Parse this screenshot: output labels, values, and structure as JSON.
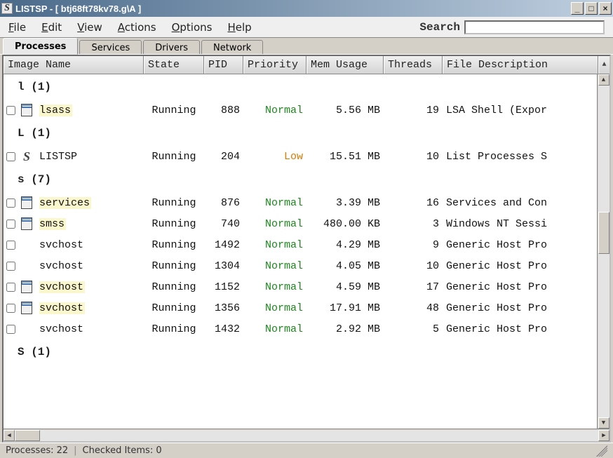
{
  "window": {
    "app": "LISTSP",
    "path": "btj68ft78kv78.g\\A",
    "title_full": "LISTSP - [ btj68ft78kv78.g\\A ]"
  },
  "menu": {
    "file": "File",
    "edit": "Edit",
    "view": "View",
    "actions": "Actions",
    "options": "Options",
    "help": "Help"
  },
  "search": {
    "label": "Search",
    "value": ""
  },
  "tabs": {
    "processes": "Processes",
    "services": "Services",
    "drivers": "Drivers",
    "network": "Network",
    "active": "processes"
  },
  "columns": {
    "image_name": "Image Name",
    "state": "State",
    "pid": "PID",
    "priority": "Priority",
    "mem_usage": "Mem Usage",
    "threads": "Threads",
    "file_description": "File Description"
  },
  "groups": [
    {
      "letter": "l",
      "count": 1,
      "rows": [
        {
          "name": "lsass",
          "highlight": true,
          "state": "Running",
          "pid": "888",
          "priority": "Normal",
          "priority_class": "normal",
          "mem": "5.56 MB",
          "threads": "19",
          "desc": "LSA Shell (Expor",
          "icon": "proc"
        }
      ]
    },
    {
      "letter": "L",
      "count": 1,
      "rows": [
        {
          "name": "LISTSP",
          "highlight": false,
          "state": "Running",
          "pid": "204",
          "priority": "Low",
          "priority_class": "low",
          "mem": "15.51 MB",
          "threads": "10",
          "desc": "List Processes S",
          "icon": "listsp"
        }
      ]
    },
    {
      "letter": "s",
      "count": 7,
      "rows": [
        {
          "name": "services",
          "highlight": true,
          "state": "Running",
          "pid": "876",
          "priority": "Normal",
          "priority_class": "normal",
          "mem": "3.39 MB",
          "threads": "16",
          "desc": "Services and Con",
          "icon": "proc"
        },
        {
          "name": "smss",
          "highlight": true,
          "state": "Running",
          "pid": "740",
          "priority": "Normal",
          "priority_class": "normal",
          "mem": "480.00 KB",
          "threads": "3",
          "desc": "Windows NT Sessi",
          "icon": "proc"
        },
        {
          "name": "svchost",
          "highlight": false,
          "state": "Running",
          "pid": "1492",
          "priority": "Normal",
          "priority_class": "normal",
          "mem": "4.29 MB",
          "threads": "9",
          "desc": "Generic Host Pro",
          "icon": "none"
        },
        {
          "name": "svchost",
          "highlight": false,
          "state": "Running",
          "pid": "1304",
          "priority": "Normal",
          "priority_class": "normal",
          "mem": "4.05 MB",
          "threads": "10",
          "desc": "Generic Host Pro",
          "icon": "none"
        },
        {
          "name": "svchost",
          "highlight": true,
          "state": "Running",
          "pid": "1152",
          "priority": "Normal",
          "priority_class": "normal",
          "mem": "4.59 MB",
          "threads": "17",
          "desc": "Generic Host Pro",
          "icon": "proc"
        },
        {
          "name": "svchost",
          "highlight": true,
          "state": "Running",
          "pid": "1356",
          "priority": "Normal",
          "priority_class": "normal",
          "mem": "17.91 MB",
          "threads": "48",
          "desc": "Generic Host Pro",
          "icon": "proc"
        },
        {
          "name": "svchost",
          "highlight": false,
          "state": "Running",
          "pid": "1432",
          "priority": "Normal",
          "priority_class": "normal",
          "mem": "2.92 MB",
          "threads": "5",
          "desc": "Generic Host Pro",
          "icon": "none"
        }
      ]
    },
    {
      "letter": "S",
      "count": 1,
      "rows": []
    }
  ],
  "status": {
    "processes_label": "Processes:",
    "processes_count": "22",
    "checked_label": "Checked Items:",
    "checked_count": "0"
  }
}
